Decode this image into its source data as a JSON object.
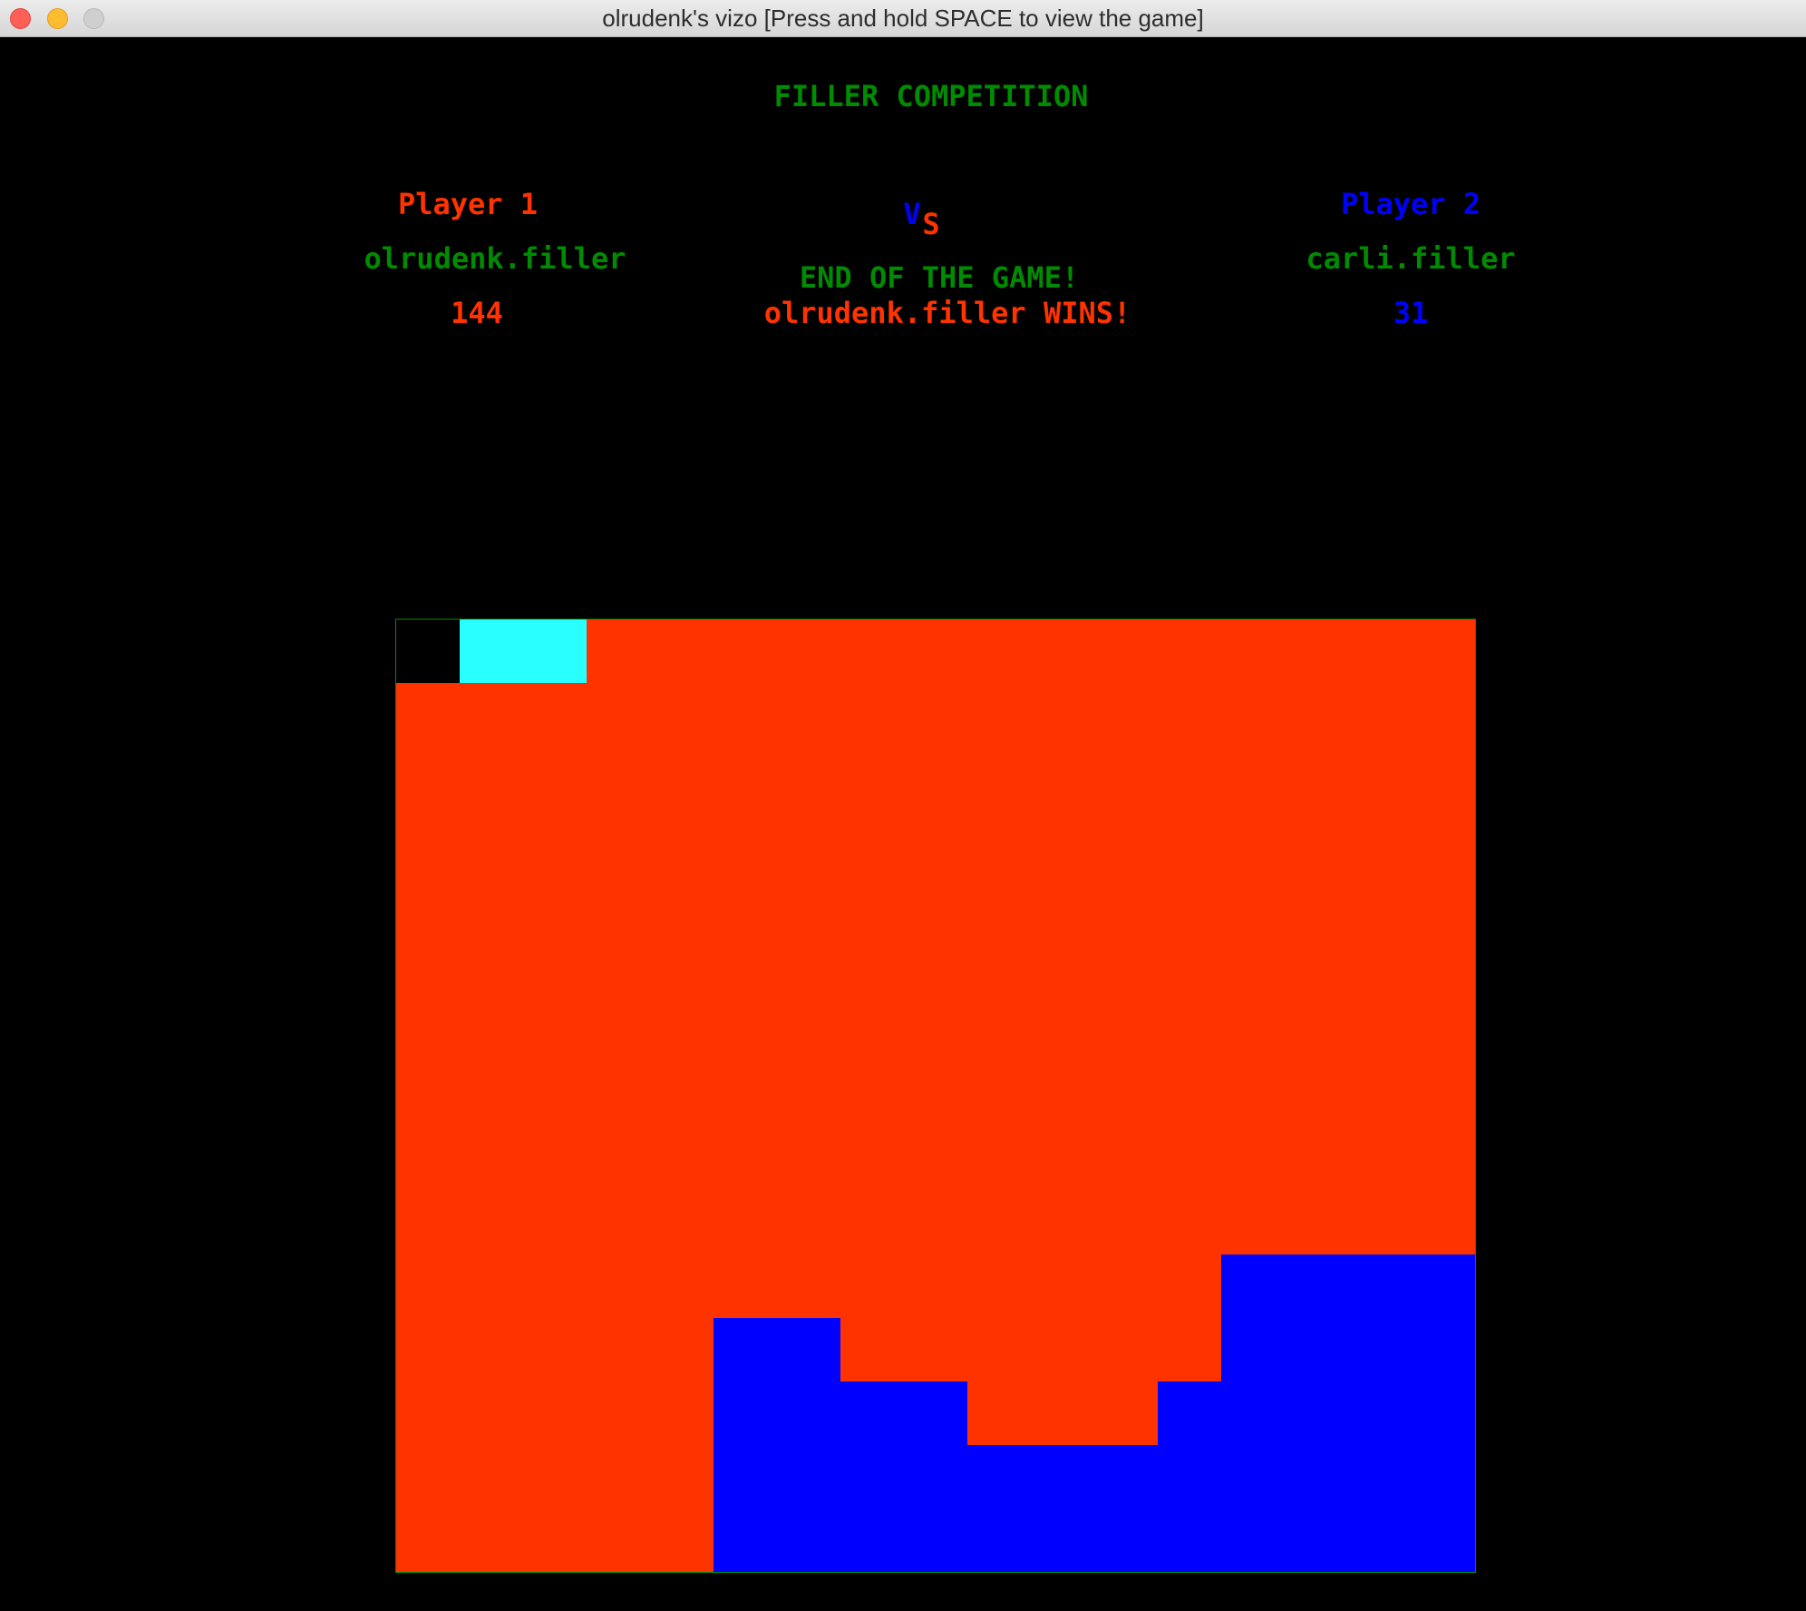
{
  "window": {
    "title": "olrudenk's vizo [Press and hold SPACE to view the game]"
  },
  "header": {
    "competition_title": "FILLER COMPETITION",
    "vs_v": "V",
    "vs_s": "S"
  },
  "player1": {
    "label": "Player 1",
    "name": "olrudenk.filler",
    "score": "144",
    "color": "#ff3300"
  },
  "player2": {
    "label": "Player 2",
    "name": "carli.filler",
    "score": "31",
    "color": "#0000ff"
  },
  "result": {
    "status": "END OF THE GAME!",
    "winner": "olrudenk.filler WINS!"
  },
  "colors": {
    "text": "#008b00",
    "empty": "#000000",
    "player1": "#ff3300",
    "player2": "#0000ff",
    "last_piece": "#29ffff"
  },
  "board": {
    "rows": 15,
    "cols": 17,
    "grid": [
      ".LLOOOOOOOOOOOOOO",
      "OOOOOOOOOOOOOOOOO",
      "OOOOOOOOOOOOOOOOO",
      "OOOOOOOOOOOOOOOOO",
      "OOOOOOOOOOOOOOOOO",
      "OOOOOOOOOOOOOOOOO",
      "OOOOOOOOOOOOOOOOO",
      "OOOOOOOOOOOOOOOOO",
      "OOOOOOOOOOOOOOOOO",
      "OOOOOOOOOOOOOOOOO",
      "OOOOOOOOOOOOOXXXX",
      "OOOOOXXOOOOOOXXXX",
      "OOOOOXXXXOOOXXXXX",
      "OOOOOXXXXXXXXXXXX",
      "OOOOOXXXXXXXXXXXX"
    ]
  }
}
